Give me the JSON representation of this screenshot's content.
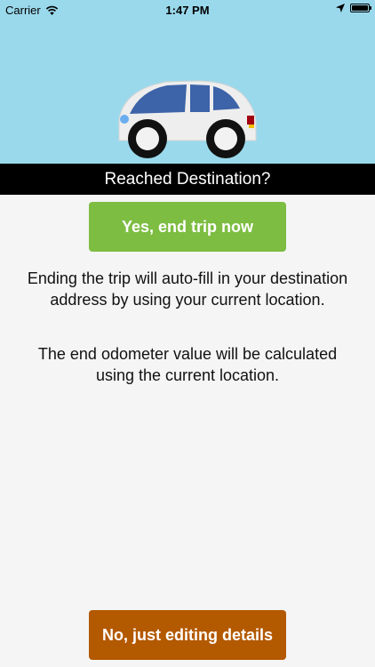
{
  "status_bar": {
    "carrier": "Carrier",
    "time": "1:47 PM"
  },
  "icons": {
    "wifi": "wifi-icon",
    "location": "location-arrow-icon",
    "battery": "battery-icon",
    "car": "car-illustration"
  },
  "title": "Reached Destination?",
  "yes_button": "Yes, end trip now",
  "message_auto_fill": "Ending the trip will auto-fill in your destination address by using your current location.",
  "message_odometer": "The end odometer value will be calculated using the current location.",
  "no_button": "No, just editing details",
  "colors": {
    "hero_background": "#9ad9ec",
    "yes_button": "#7dbd42",
    "no_button": "#b35900",
    "title_bar": "#000000",
    "car_window": "#3d63a8",
    "car_body": "#eeeeee"
  }
}
